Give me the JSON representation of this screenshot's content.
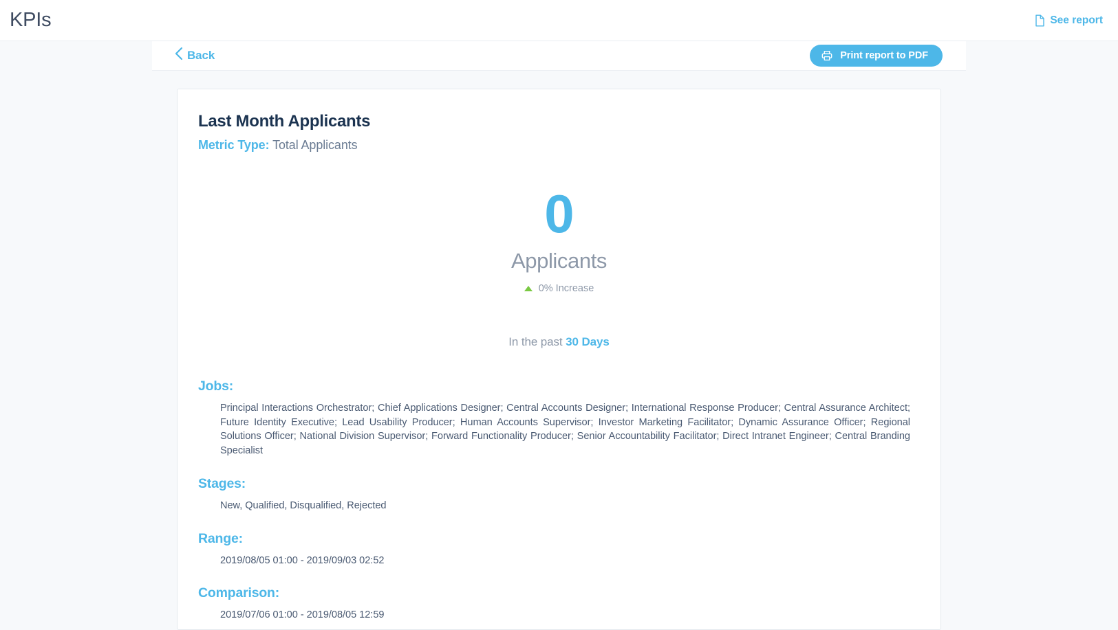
{
  "appbar": {
    "title": "KPIs",
    "see_report_label": "See report",
    "see_report_icon": "document-icon"
  },
  "toolbar": {
    "back_label": "Back",
    "back_icon": "chevron-left-icon",
    "print_label": "Print report to PDF",
    "print_icon": "printer-icon"
  },
  "report": {
    "title": "Last Month Applicants",
    "metric_type_label": "Metric Type:",
    "metric_type_value": "Total Applicants",
    "stat": {
      "value": "0",
      "unit": "Applicants",
      "delta_text": "0% Increase",
      "delta_direction": "up",
      "delta_color": "#7ac943"
    },
    "period": {
      "prefix": "In the past",
      "value": "30 Days"
    },
    "sections": [
      {
        "heading": "Jobs:",
        "body": "Principal Interactions Orchestrator; Chief Applications Designer; Central Accounts Designer; International Response Producer; Central Assurance Architect; Future Identity Executive; Lead Usability Producer; Human Accounts Supervisor; Investor Marketing Facilitator; Dynamic Assurance Officer; Regional Solutions Officer; National Division Supervisor; Forward Functionality Producer; Senior Accountability Facilitator; Direct Intranet Engineer; Central Branding Specialist"
      },
      {
        "heading": "Stages:",
        "body": "New, Qualified, Disqualified, Rejected"
      },
      {
        "heading": "Range:",
        "body": "2019/08/05 01:00 - 2019/09/03 02:52"
      },
      {
        "heading": "Comparison:",
        "body": "2019/07/06 01:00 - 2019/08/05 12:59"
      }
    ]
  },
  "colors": {
    "accent": "#4db7e8",
    "title_navy": "#1b3350",
    "muted_gray": "#8d98a8",
    "body_text": "#4a5a72",
    "page_bg": "#f7f9fb",
    "positive_green": "#7ac943"
  }
}
